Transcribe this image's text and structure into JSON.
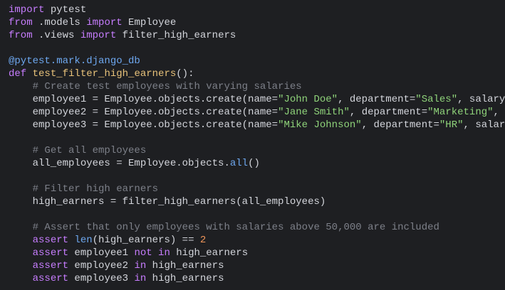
{
  "editor": {
    "language": "python",
    "colors": {
      "background": "#1e1f22",
      "keyword": "#c77dff",
      "function": "#e8c27a",
      "string": "#8fd37a",
      "comment": "#7d8089",
      "number": "#f0955a",
      "decorator": "#6ea8f0"
    },
    "lines": [
      [
        [
          "kw",
          "import"
        ],
        [
          "tx",
          " pytest"
        ]
      ],
      [
        [
          "kw",
          "from"
        ],
        [
          "tx",
          " .models "
        ],
        [
          "kw",
          "import"
        ],
        [
          "tx",
          " Employee"
        ]
      ],
      [
        [
          "kw",
          "from"
        ],
        [
          "tx",
          " .views "
        ],
        [
          "kw",
          "import"
        ],
        [
          "tx",
          " filter_high_earners"
        ]
      ],
      [],
      [
        [
          "dec",
          "@pytest.mark.django_db"
        ]
      ],
      [
        [
          "kw",
          "def"
        ],
        [
          "tx",
          " "
        ],
        [
          "fn",
          "test_filter_high_earners"
        ],
        [
          "tx",
          "():"
        ]
      ],
      [
        [
          "tx",
          "    "
        ],
        [
          "cm",
          "# Create test employees with varying salaries"
        ]
      ],
      [
        [
          "tx",
          "    employee1 = Employee.objects.create(name="
        ],
        [
          "str",
          "\"John Doe\""
        ],
        [
          "tx",
          ", department="
        ],
        [
          "str",
          "\"Sales\""
        ],
        [
          "tx",
          ", salary"
        ]
      ],
      [
        [
          "tx",
          "    employee2 = Employee.objects.create(name="
        ],
        [
          "str",
          "\"Jane Smith\""
        ],
        [
          "tx",
          ", department="
        ],
        [
          "str",
          "\"Marketing\""
        ],
        [
          "tx",
          ","
        ]
      ],
      [
        [
          "tx",
          "    employee3 = Employee.objects.create(name="
        ],
        [
          "str",
          "\"Mike Johnson\""
        ],
        [
          "tx",
          ", department="
        ],
        [
          "str",
          "\"HR\""
        ],
        [
          "tx",
          ", salar"
        ]
      ],
      [],
      [
        [
          "tx",
          "    "
        ],
        [
          "cm",
          "# Get all employees"
        ]
      ],
      [
        [
          "tx",
          "    all_employees = Employee.objects."
        ],
        [
          "bi",
          "all"
        ],
        [
          "tx",
          "()"
        ]
      ],
      [],
      [
        [
          "tx",
          "    "
        ],
        [
          "cm",
          "# Filter high earners"
        ]
      ],
      [
        [
          "tx",
          "    high_earners = filter_high_earners(all_employees)"
        ]
      ],
      [],
      [
        [
          "tx",
          "    "
        ],
        [
          "cm",
          "# Assert that only employees with salaries above 50,000 are included"
        ]
      ],
      [
        [
          "tx",
          "    "
        ],
        [
          "kw",
          "assert"
        ],
        [
          "tx",
          " "
        ],
        [
          "bi",
          "len"
        ],
        [
          "tx",
          "(high_earners) == "
        ],
        [
          "num",
          "2"
        ]
      ],
      [
        [
          "tx",
          "    "
        ],
        [
          "kw",
          "assert"
        ],
        [
          "tx",
          " employee1 "
        ],
        [
          "kw",
          "not in"
        ],
        [
          "tx",
          " high_earners"
        ]
      ],
      [
        [
          "tx",
          "    "
        ],
        [
          "kw",
          "assert"
        ],
        [
          "tx",
          " employee2 "
        ],
        [
          "kw",
          "in"
        ],
        [
          "tx",
          " high_earners"
        ]
      ],
      [
        [
          "tx",
          "    "
        ],
        [
          "kw",
          "assert"
        ],
        [
          "tx",
          " employee3 "
        ],
        [
          "kw",
          "in"
        ],
        [
          "tx",
          " high_earners"
        ]
      ]
    ]
  }
}
